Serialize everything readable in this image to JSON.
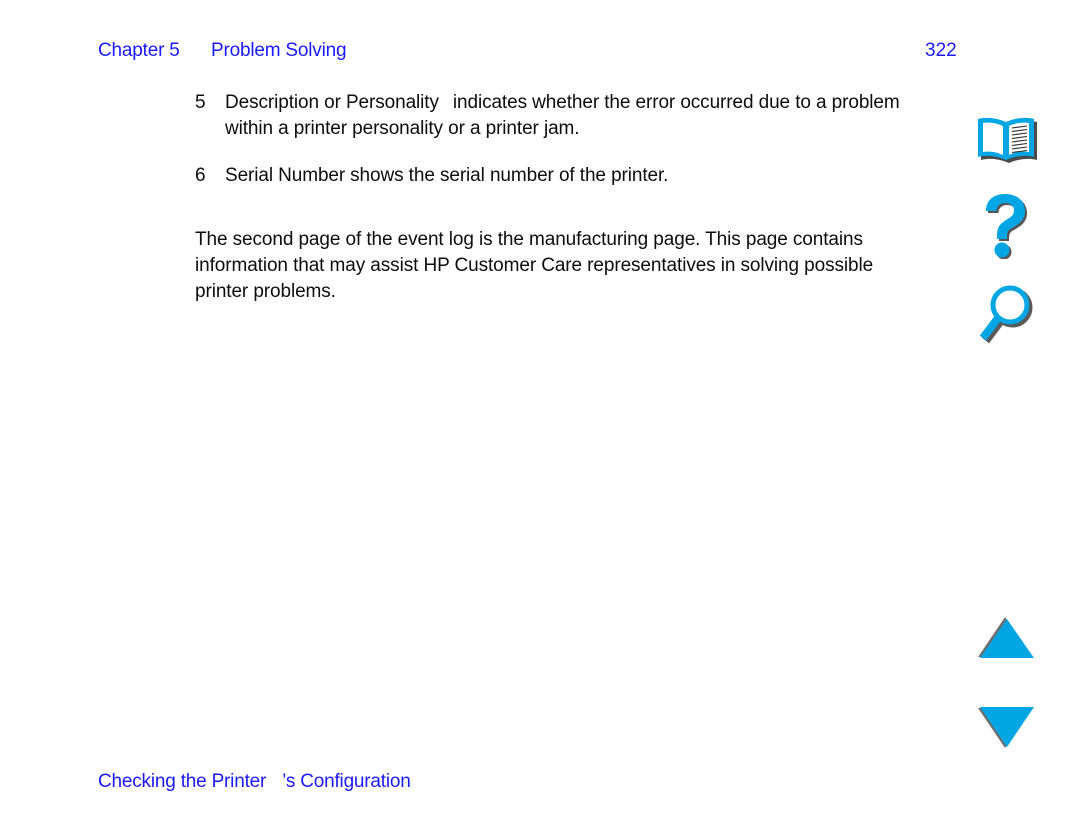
{
  "header": {
    "chapter_label": "Chapter 5",
    "section_title": "Problem Solving",
    "page_number": "322"
  },
  "colors": {
    "link_blue": "#1a1aff",
    "icon_cyan": "#00A6E3",
    "icon_shadow": "#6e6e6e",
    "body_text": "#0d0d0d"
  },
  "main": {
    "items": [
      {
        "number": "5",
        "term": "Description or Personality",
        "text": "indicates whether the error occurred due to a problem within a printer personality or a printer jam."
      },
      {
        "number": "6",
        "term": "Serial Number",
        "text": "shows the serial number of the printer."
      }
    ],
    "paragraph": "The second page of the event log is the manufacturing page. This page contains information that may assist HP Customer Care representatives in solving possible printer problems."
  },
  "footer": {
    "link_part_1": "Checking the Printer",
    "link_part_2": "’s Configuration"
  },
  "nav_rail": {
    "buttons": [
      {
        "name": "book-icon",
        "label": "Table of Contents"
      },
      {
        "name": "question-mark-icon",
        "label": "Help"
      },
      {
        "name": "magnifier-icon",
        "label": "Search"
      },
      {
        "name": "triangle-up-icon",
        "label": "Previous Page"
      },
      {
        "name": "triangle-down-icon",
        "label": "Next Page"
      }
    ]
  }
}
